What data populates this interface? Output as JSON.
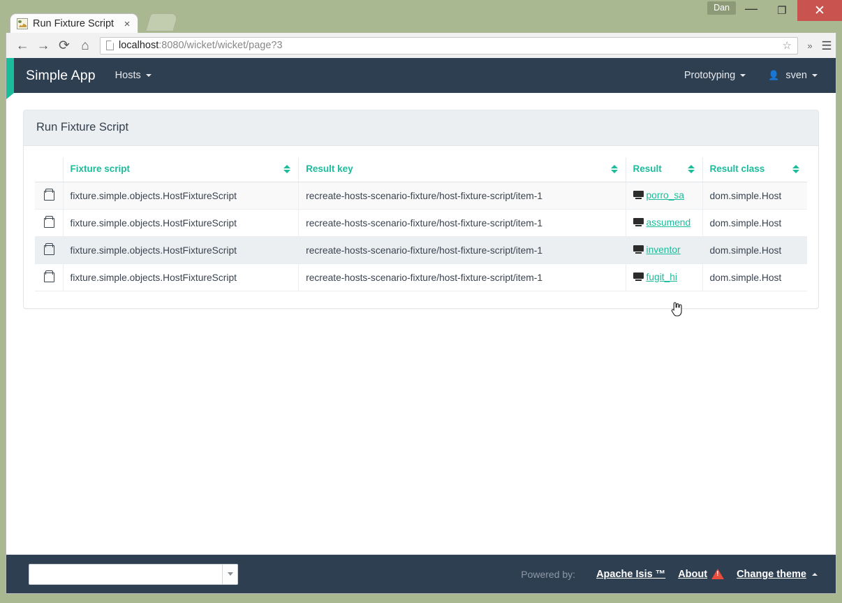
{
  "browser": {
    "tab_title": "Run Fixture Script",
    "tab_close": "×",
    "taskbar_label": "Dan",
    "window_minimize": "—",
    "window_maximize": "❐",
    "window_close": "✕",
    "back_icon": "←",
    "forward_icon": "→",
    "reload_icon": "⟳",
    "home_icon": "⌂",
    "url_host": "localhost",
    "url_rest": ":8080/wicket/wicket/page?3",
    "star_icon": "☆",
    "overflow_icon": "»",
    "menu_icon": "☰"
  },
  "navbar": {
    "brand": "Simple App",
    "items": [
      {
        "label": "Hosts",
        "has_caret": true
      }
    ],
    "right_items": [
      {
        "label": "Prototyping",
        "has_caret": true
      },
      {
        "label": "sven",
        "has_caret": true
      }
    ],
    "accent_color": "#1abc9c",
    "background_color": "#2e3f52"
  },
  "panel": {
    "title": "Run Fixture Script"
  },
  "table": {
    "columns": [
      {
        "label": "",
        "sortable": false
      },
      {
        "label": "Fixture script",
        "sortable": true
      },
      {
        "label": "Result key",
        "sortable": true
      },
      {
        "label": "Result",
        "sortable": true
      },
      {
        "label": "Result class",
        "sortable": true
      }
    ],
    "rows": [
      {
        "icon": "cube-icon",
        "fixture_script": "fixture.simple.objects.HostFixtureScript",
        "result_key": "recreate-hosts-scenario-fixture/host-fixture-script/item-1",
        "result": "porro_sa",
        "result_class": "dom.simple.Host"
      },
      {
        "icon": "cube-icon",
        "fixture_script": "fixture.simple.objects.HostFixtureScript",
        "result_key": "recreate-hosts-scenario-fixture/host-fixture-script/item-1",
        "result": "assumend",
        "result_class": "dom.simple.Host"
      },
      {
        "icon": "cube-icon",
        "fixture_script": "fixture.simple.objects.HostFixtureScript",
        "result_key": "recreate-hosts-scenario-fixture/host-fixture-script/item-1",
        "result": "inventor",
        "result_class": "dom.simple.Host"
      },
      {
        "icon": "cube-icon",
        "fixture_script": "fixture.simple.objects.HostFixtureScript",
        "result_key": "recreate-hosts-scenario-fixture/host-fixture-script/item-1",
        "result": "fugit_hi",
        "result_class": "dom.simple.Host"
      }
    ]
  },
  "footer": {
    "theme_select_value": "",
    "powered_by": "Powered by:",
    "apache_isis": "Apache Isis ™",
    "about": "About",
    "change_theme": "Change theme"
  }
}
